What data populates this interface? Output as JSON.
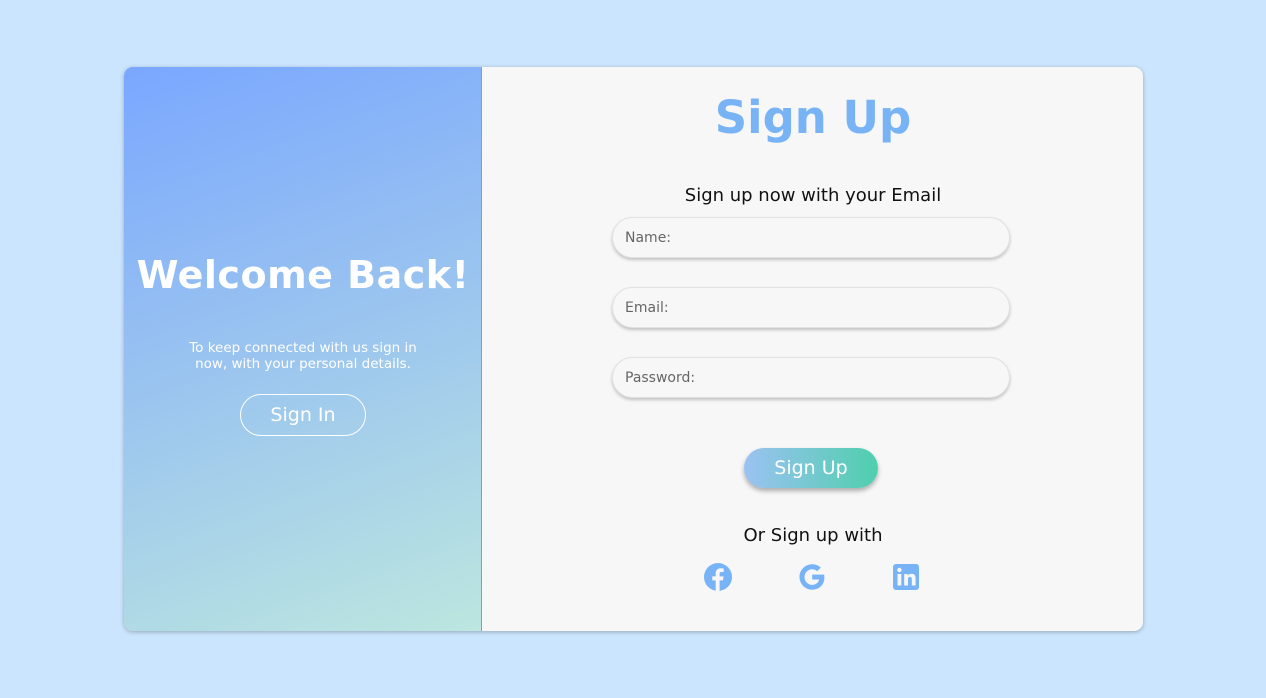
{
  "left_panel": {
    "title": "Welcome Back!",
    "text": "To keep connected with us sign in now, with your personal details.",
    "signin_label": "Sign In"
  },
  "right_panel": {
    "title": "Sign Up",
    "subtitle": "Sign up now with your Email",
    "fields": {
      "name_placeholder": "Name:",
      "email_placeholder": "Email:",
      "password_placeholder": "Password:"
    },
    "signup_label": "Sign Up",
    "or_text": "Or Sign up with",
    "social_icons": [
      "facebook-icon",
      "google-icon",
      "linkedin-icon"
    ]
  },
  "colors": {
    "background": "#cbe5fe",
    "accent": "#78b3f6",
    "button_gradient_start": "#9bc2f2",
    "button_gradient_end": "#4fcfad"
  }
}
